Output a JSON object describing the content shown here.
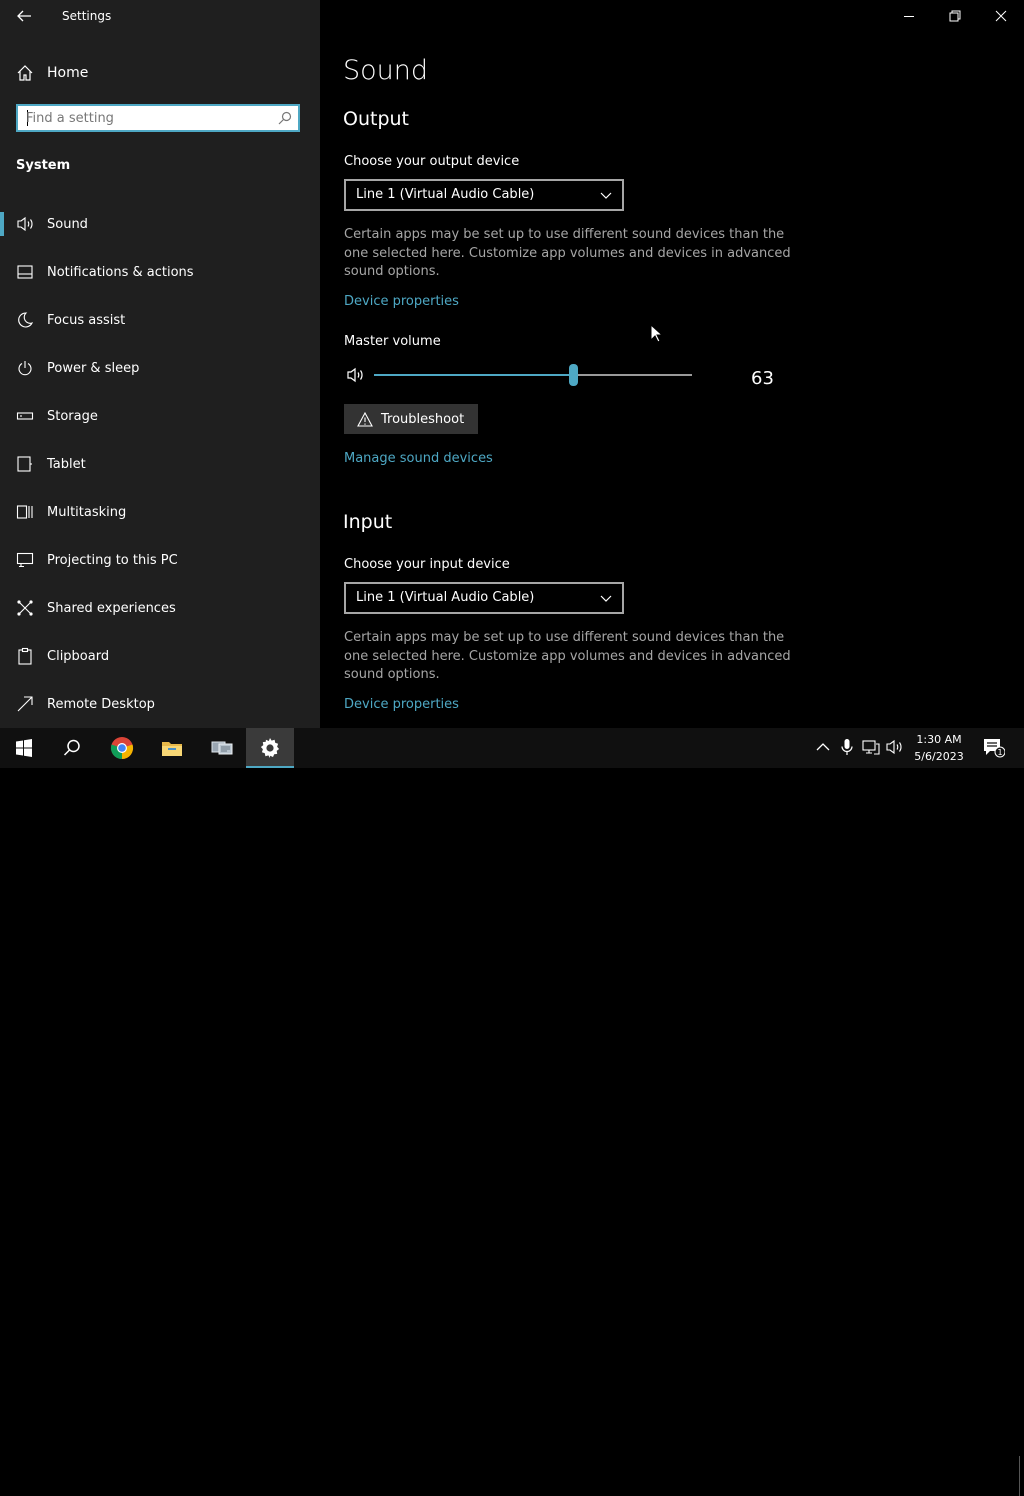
{
  "window": {
    "title": "Settings"
  },
  "sidebar": {
    "home_label": "Home",
    "search_placeholder": "Find a setting",
    "section": "System",
    "items": [
      {
        "label": "Sound",
        "icon": "speaker-icon",
        "selected": true
      },
      {
        "label": "Notifications & actions",
        "icon": "notification-icon"
      },
      {
        "label": "Focus assist",
        "icon": "moon-icon"
      },
      {
        "label": "Power & sleep",
        "icon": "power-icon"
      },
      {
        "label": "Storage",
        "icon": "storage-icon"
      },
      {
        "label": "Tablet",
        "icon": "tablet-icon"
      },
      {
        "label": "Multitasking",
        "icon": "multitasking-icon"
      },
      {
        "label": "Projecting to this PC",
        "icon": "projecting-icon"
      },
      {
        "label": "Shared experiences",
        "icon": "shared-icon"
      },
      {
        "label": "Clipboard",
        "icon": "clipboard-icon"
      },
      {
        "label": "Remote Desktop",
        "icon": "remote-desktop-icon"
      }
    ]
  },
  "main": {
    "title": "Sound",
    "output": {
      "heading": "Output",
      "device_label": "Choose your output device",
      "device_value": "Line 1 (Virtual Audio Cable)",
      "description": "Certain apps may be set up to use different sound devices than the one selected here. Customize app volumes and devices in advanced sound options.",
      "device_properties_link": "Device properties",
      "master_volume_label": "Master volume",
      "master_volume_value": "63",
      "master_volume_level": 63,
      "troubleshoot_label": "Troubleshoot",
      "manage_link": "Manage sound devices"
    },
    "input": {
      "heading": "Input",
      "device_label": "Choose your input device",
      "device_value": "Line 1 (Virtual Audio Cable)",
      "description": "Certain apps may be set up to use different sound devices than the one selected here. Customize app volumes and devices in advanced sound options.",
      "device_properties_link": "Device properties"
    }
  },
  "taskbar": {
    "time": "1:30 AM",
    "date": "5/6/2023",
    "notification_count": "1",
    "apps": [
      "windows-start-icon",
      "search-icon",
      "chrome-icon",
      "file-explorer-icon",
      "network-app-icon",
      "settings-gear-icon"
    ]
  },
  "colors": {
    "accent": "#4ea8c4",
    "sidebar_bg": "#1f1f1f",
    "main_bg": "#000000",
    "secondary_text": "#a6a6a6"
  }
}
